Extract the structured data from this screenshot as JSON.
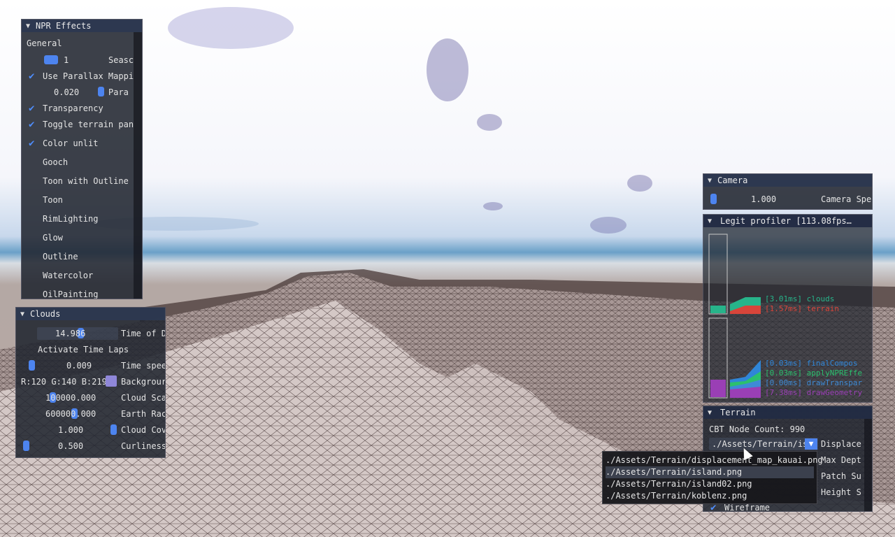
{
  "npr_panel": {
    "title": "NPR Effects",
    "section_general": "General",
    "season_value": "1",
    "season_label": "Seasc",
    "use_parallax_label": "Use Parallax Mappi",
    "parallax_value": "0.020",
    "parallax_label": "Para",
    "transparency_label": "Transparency",
    "toggle_terrain_label": "Toggle terrain pan",
    "color_unlit_label": "Color unlit",
    "gooch_label": "Gooch",
    "toon_outline_label": "Toon with Outline",
    "toon_label": "Toon",
    "rimlighting_label": "RimLighting",
    "glow_label": "Glow",
    "outline_label": "Outline",
    "watercolor_label": "Watercolor",
    "oilpainting_label": "OilPainting"
  },
  "clouds_panel": {
    "title": "Clouds",
    "time_of_day_value": "14.986",
    "time_of_day_label": "Time of D",
    "activate_time_laps": "Activate Time Laps",
    "time_speed_value": "0.009",
    "time_speed_label": "Time spee",
    "background_rgb": "R:120 G:140 B:219",
    "background_label": "Backgrour",
    "cloud_scale_value": "100000.000",
    "cloud_scale_label": "Cloud Sca",
    "earth_radius_value": "600000.000",
    "earth_radius_label": "Earth Rac",
    "cloud_coverage_value": "1.000",
    "cloud_coverage_label": "Cloud Cov",
    "curliness_value": "0.500",
    "curliness_label": "Curliness"
  },
  "camera_panel": {
    "title": "Camera",
    "speed_value": "1.000",
    "speed_label": "Camera Spe"
  },
  "profiler_panel": {
    "title": "Legit profiler [113.08fps…",
    "entries_top": [
      {
        "text": "[3.01ms] clouds",
        "color": "#27b48a"
      },
      {
        "text": "[1.57ms] terrain",
        "color": "#d8453a"
      }
    ],
    "entries_bottom": [
      {
        "text": "[0.03ms] finalCompos",
        "color": "#2f86d8"
      },
      {
        "text": "[0.03ms] applyNPREffe",
        "color": "#2bc06e"
      },
      {
        "text": "[0.00ms] drawTranspar",
        "color": "#3e8bd6"
      },
      {
        "text": "[7.38ms] drawGeometry",
        "color": "#9a3fb5"
      }
    ]
  },
  "terrain_panel": {
    "title": "Terrain",
    "node_count": "CBT Node Count: 990",
    "displacement_combo_value": "./Assets/Terrain/is",
    "displacement_label": "Displace",
    "max_depth_label": "Max Dept",
    "patch_label": "Patch Su",
    "height_label": "Height S",
    "wireframe_label": "Wireframe"
  },
  "dropdown": {
    "options": [
      "./Assets/Terrain/displacement_map_kauai.png",
      "./Assets/Terrain/island.png",
      "./Assets/Terrain/island02.png",
      "./Assets/Terrain/koblenz.png"
    ]
  },
  "icons": {
    "collapse": "triangle-down-icon",
    "check": "checkmark-icon",
    "combo": "dropdown-arrow-icon"
  },
  "colors": {
    "accent": "#4d84ef",
    "panel_bg": "#212530",
    "title_bg": "#2d3850",
    "background_swatch": "#8f87d9"
  }
}
